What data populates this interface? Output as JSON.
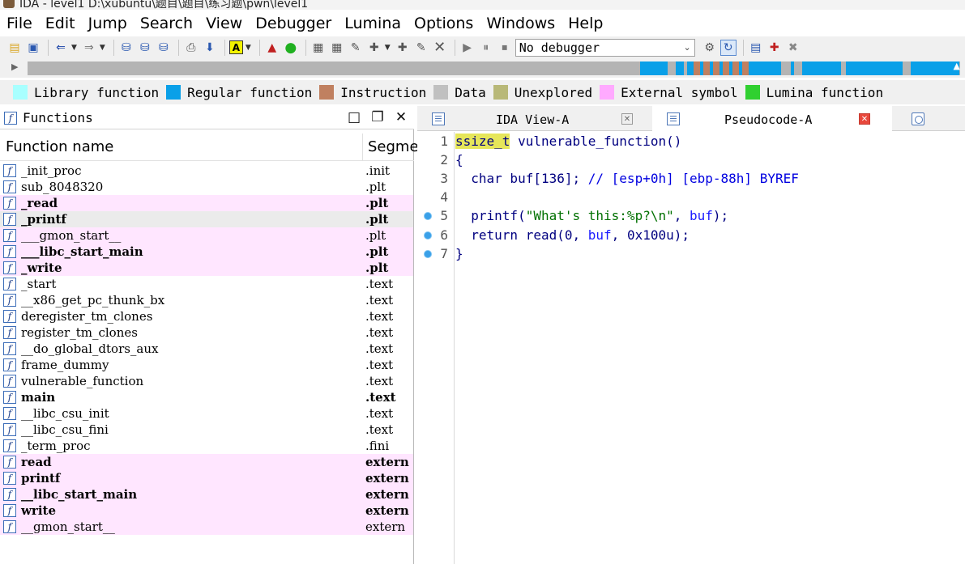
{
  "window": {
    "title": "IDA - level1 D:\\xubuntu\\题目\\题目\\练习题\\pwn\\level1"
  },
  "menu": [
    "File",
    "Edit",
    "Jump",
    "Search",
    "View",
    "Debugger",
    "Lumina",
    "Options",
    "Windows",
    "Help"
  ],
  "toolbar": {
    "debugger_selected": "No debugger"
  },
  "legend": [
    {
      "label": "Library function",
      "color": "#a8ffff"
    },
    {
      "label": "Regular function",
      "color": "#0aa0e8"
    },
    {
      "label": "Instruction",
      "color": "#c08060"
    },
    {
      "label": "Data",
      "color": "#c0c0c0"
    },
    {
      "label": "Unexplored",
      "color": "#b8b878"
    },
    {
      "label": "External symbol",
      "color": "#ffaaff"
    },
    {
      "label": "Lumina function",
      "color": "#30d030"
    }
  ],
  "functions_panel": {
    "title": "Functions",
    "col_name": "Function name",
    "col_segment": "Segme",
    "rows": [
      {
        "name": "_init_proc",
        "segment": ".init",
        "ext": false,
        "bold": false,
        "sel": false
      },
      {
        "name": "sub_8048320",
        "segment": ".plt",
        "ext": false,
        "bold": false,
        "sel": false
      },
      {
        "name": "_read",
        "segment": ".plt",
        "ext": true,
        "bold": true,
        "sel": false
      },
      {
        "name": "_printf",
        "segment": ".plt",
        "ext": false,
        "bold": true,
        "sel": true
      },
      {
        "name": "___gmon_start__",
        "segment": ".plt",
        "ext": true,
        "bold": false,
        "sel": false
      },
      {
        "name": "___libc_start_main",
        "segment": ".plt",
        "ext": true,
        "bold": true,
        "sel": false
      },
      {
        "name": "_write",
        "segment": ".plt",
        "ext": true,
        "bold": true,
        "sel": false
      },
      {
        "name": "_start",
        "segment": ".text",
        "ext": false,
        "bold": false,
        "sel": false
      },
      {
        "name": "__x86_get_pc_thunk_bx",
        "segment": ".text",
        "ext": false,
        "bold": false,
        "sel": false
      },
      {
        "name": "deregister_tm_clones",
        "segment": ".text",
        "ext": false,
        "bold": false,
        "sel": false
      },
      {
        "name": "register_tm_clones",
        "segment": ".text",
        "ext": false,
        "bold": false,
        "sel": false
      },
      {
        "name": "__do_global_dtors_aux",
        "segment": ".text",
        "ext": false,
        "bold": false,
        "sel": false
      },
      {
        "name": "frame_dummy",
        "segment": ".text",
        "ext": false,
        "bold": false,
        "sel": false
      },
      {
        "name": "vulnerable_function",
        "segment": ".text",
        "ext": false,
        "bold": false,
        "sel": false
      },
      {
        "name": "main",
        "segment": ".text",
        "ext": false,
        "bold": true,
        "sel": false
      },
      {
        "name": "__libc_csu_init",
        "segment": ".text",
        "ext": false,
        "bold": false,
        "sel": false
      },
      {
        "name": "__libc_csu_fini",
        "segment": ".text",
        "ext": false,
        "bold": false,
        "sel": false
      },
      {
        "name": "_term_proc",
        "segment": ".fini",
        "ext": false,
        "bold": false,
        "sel": false
      },
      {
        "name": "read",
        "segment": "extern",
        "ext": true,
        "bold": true,
        "sel": false
      },
      {
        "name": "printf",
        "segment": "extern",
        "ext": true,
        "bold": true,
        "sel": false
      },
      {
        "name": "__libc_start_main",
        "segment": "extern",
        "ext": true,
        "bold": true,
        "sel": false
      },
      {
        "name": "write",
        "segment": "extern",
        "ext": true,
        "bold": true,
        "sel": false
      },
      {
        "name": "__gmon_start__",
        "segment": "extern",
        "ext": true,
        "bold": false,
        "sel": false
      }
    ]
  },
  "tabs": [
    {
      "label": "IDA View-A",
      "active": false
    },
    {
      "label": "Pseudocode-A",
      "active": true
    }
  ],
  "pseudocode": {
    "lines": [
      {
        "n": "1",
        "dot": false,
        "parts": [
          [
            "k-type",
            "ssize_t"
          ],
          [
            "k-id",
            " vulnerable_function"
          ],
          [
            "k-punc",
            "()"
          ]
        ]
      },
      {
        "n": "2",
        "dot": false,
        "parts": [
          [
            "k-punc",
            "{"
          ]
        ]
      },
      {
        "n": "3",
        "dot": false,
        "parts": [
          [
            "k-id",
            "  char buf[136]; "
          ],
          [
            "k-cmt",
            "// [esp+0h] [ebp-88h] BYREF"
          ]
        ]
      },
      {
        "n": "4",
        "dot": false,
        "parts": []
      },
      {
        "n": "5",
        "dot": true,
        "parts": [
          [
            "k-id",
            "  printf("
          ],
          [
            "k-str",
            "\"What's this:%p?\\n\""
          ],
          [
            "k-punc",
            ", "
          ],
          [
            "k-var",
            "buf"
          ],
          [
            "k-punc",
            ");"
          ]
        ]
      },
      {
        "n": "6",
        "dot": true,
        "parts": [
          [
            "k-id",
            "  return read("
          ],
          [
            "k-num",
            "0"
          ],
          [
            "k-punc",
            ", "
          ],
          [
            "k-var",
            "buf"
          ],
          [
            "k-punc",
            ", "
          ],
          [
            "k-num",
            "0x100u"
          ],
          [
            "k-punc",
            ");"
          ]
        ]
      },
      {
        "n": "7",
        "dot": true,
        "parts": [
          [
            "k-punc",
            "}"
          ]
        ]
      }
    ]
  }
}
